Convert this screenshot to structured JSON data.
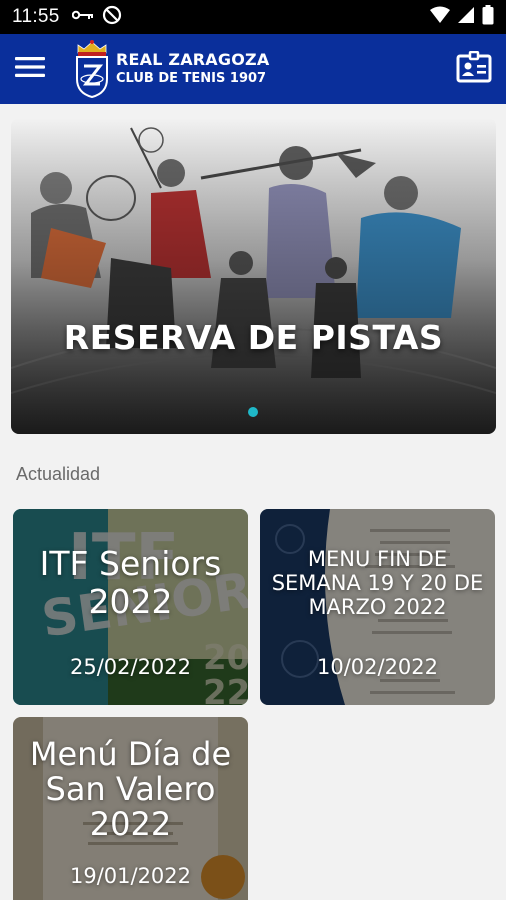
{
  "status_bar": {
    "time": "11:55",
    "icons": [
      "key-icon",
      "no-disturb-icon",
      "wifi-icon",
      "signal-icon",
      "battery-icon"
    ]
  },
  "app_bar": {
    "brand_line1": "REAL ZARAGOZA",
    "brand_line2": "CLUB DE TENIS 1907",
    "background": "#0a2f9b",
    "icons": [
      "menu-icon",
      "member-card-icon"
    ]
  },
  "banner": {
    "title": "RESERVA DE PISTAS",
    "indicator_color": "#1fb8c8",
    "active_slide": 1,
    "slide_count": 1
  },
  "section": {
    "label": "Actualidad"
  },
  "news": [
    {
      "title": "ITF Seniors 2022",
      "date": "25/02/2022"
    },
    {
      "title": "MENU FIN DE SEMANA 19 Y 20 DE MARZO 2022",
      "date": "10/02/2022"
    },
    {
      "title": "Menú Día de San Valero 2022",
      "date": "19/01/2022"
    }
  ]
}
